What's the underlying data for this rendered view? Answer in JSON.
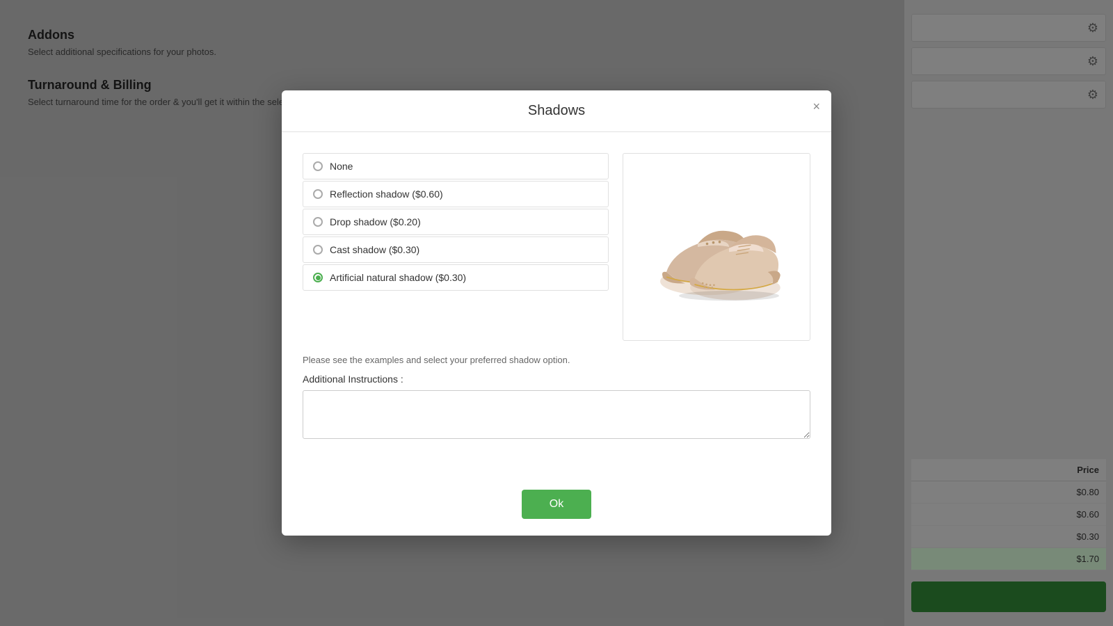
{
  "background": {
    "addons_title": "Addons",
    "addons_desc": "Select additional specifications for your photos.",
    "turnaround_title": "Turnaround & Billing",
    "turnaround_desc": "Select turnaround time for the order & you'll get it within the selecting longer turnaround time.",
    "gear_icon": "⚙",
    "table": {
      "header": "Price",
      "rows": [
        {
          "price": "$0.80"
        },
        {
          "price": "$0.60"
        },
        {
          "price": "$0.30"
        },
        {
          "price": "$1.70",
          "highlight": true
        }
      ]
    }
  },
  "modal": {
    "title": "Shadows",
    "close_label": "×",
    "options": [
      {
        "id": "none",
        "label": "None",
        "checked": false
      },
      {
        "id": "reflection",
        "label": "Reflection shadow ($0.60)",
        "checked": false
      },
      {
        "id": "drop",
        "label": "Drop shadow ($0.20)",
        "checked": false
      },
      {
        "id": "cast",
        "label": "Cast shadow ($0.30)",
        "checked": false
      },
      {
        "id": "artificial",
        "label": "Artificial natural shadow ($0.30)",
        "checked": true
      }
    ],
    "helper_text": "Please see the examples and select your preferred shadow option.",
    "additional_label": "Additional Instructions :",
    "additional_placeholder": "",
    "ok_button": "Ok"
  }
}
